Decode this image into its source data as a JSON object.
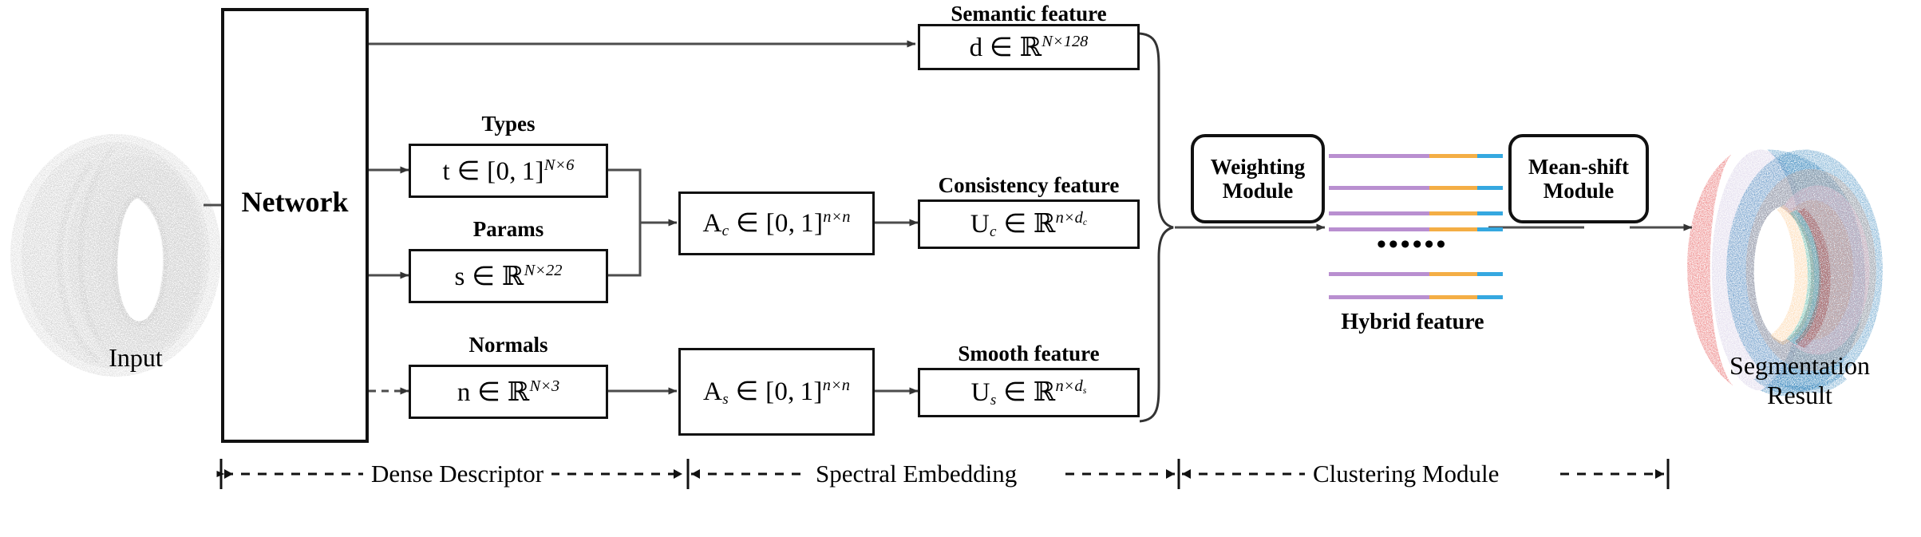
{
  "figure": {
    "input": {
      "label": "Input",
      "point_cloud": "grey-ring-point-cloud"
    },
    "network": {
      "label": "Network"
    },
    "branches": [
      {
        "caption": "Types",
        "symbol": "t",
        "relation": "∈",
        "set": "[0, 1]",
        "exp_a": "N",
        "exp_b": "6",
        "set_kind": "interval"
      },
      {
        "caption": "Params",
        "symbol": "s",
        "relation": "∈",
        "set": "ℝ",
        "exp_a": "N",
        "exp_b": "22",
        "set_kind": "reals"
      },
      {
        "caption": "Normals",
        "symbol": "n",
        "relation": "∈",
        "set": "ℝ",
        "exp_a": "N",
        "exp_b": "3",
        "set_kind": "reals"
      }
    ],
    "affinity": [
      {
        "symbol": "A",
        "sub": "c",
        "relation": "∈",
        "set": "[0, 1]",
        "exp_a": "n",
        "exp_b": "n"
      },
      {
        "symbol": "A",
        "sub": "s",
        "relation": "∈",
        "set": "[0, 1]",
        "exp_a": "n",
        "exp_b": "n"
      }
    ],
    "features": [
      {
        "caption": "Semantic feature",
        "symbol": "d",
        "sub": "",
        "relation": "∈",
        "set": "ℝ",
        "exp_a": "N",
        "exp_b": "128"
      },
      {
        "caption": "Consistency feature",
        "symbol": "U",
        "sub": "c",
        "relation": "∈",
        "set": "ℝ",
        "exp_a": "n",
        "exp_b": "d_c"
      },
      {
        "caption": "Smooth feature",
        "symbol": "U",
        "sub": "s",
        "relation": "∈",
        "set": "ℝ",
        "exp_a": "n",
        "exp_b": "d_s"
      }
    ],
    "modules": [
      {
        "line1": "Weighting",
        "line2": "Module"
      },
      {
        "line1": "Mean-shift",
        "line2": "Module"
      }
    ],
    "hybrid": {
      "label": "Hybrid feature",
      "ellipsis": "••••••",
      "row_count": 6,
      "segment_colors": [
        "#b98fd0",
        "#f4ae45",
        "#35a8e0"
      ],
      "segment_widths": [
        126,
        60,
        32
      ]
    },
    "output": {
      "line1": "Segmentation",
      "line2": "Result"
    },
    "sections": [
      {
        "label": "Dense  Descriptor"
      },
      {
        "label": "Spectral Embedding"
      },
      {
        "label": "Clustering Module"
      }
    ],
    "colors": {
      "ink": "#111111",
      "arrow": "#4d4d4d",
      "pointcloud": "#c9c9c9",
      "seg_red": "#e03030",
      "seg_lavender": "#c9bede",
      "seg_blue": "#1f77b4",
      "seg_tan": "#c49a87",
      "seg_pink": "#f6bdd2",
      "seg_orange": "#fcc280",
      "seg_cyan": "#17bece",
      "seg_maroon": "#9c3434"
    }
  }
}
